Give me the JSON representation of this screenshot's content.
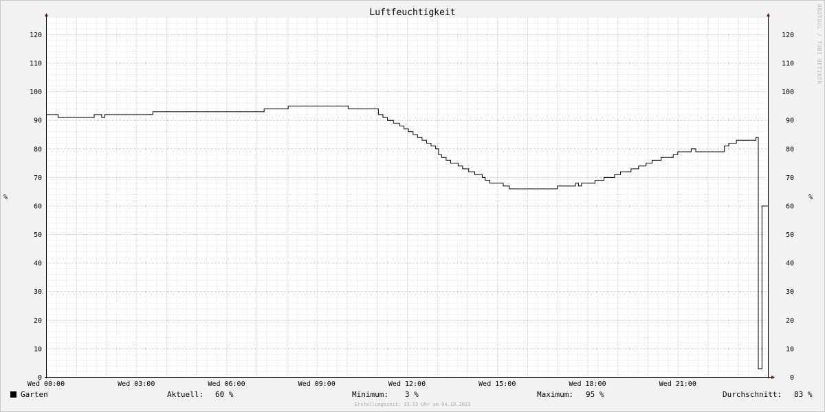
{
  "chart_data": {
    "type": "line",
    "title": "Luftfeuchtigkeit",
    "ylabel_left": "%",
    "ylabel_right": "%",
    "ylim": [
      0,
      126
    ],
    "yticks": [
      0,
      10,
      20,
      30,
      40,
      50,
      60,
      70,
      80,
      90,
      100,
      110,
      120
    ],
    "xlim_hours": [
      0,
      24
    ],
    "xticks": [
      {
        "hour": 0,
        "label": "Wed 00:00"
      },
      {
        "hour": 3,
        "label": "Wed 03:00"
      },
      {
        "hour": 6,
        "label": "Wed 06:00"
      },
      {
        "hour": 9,
        "label": "Wed 09:00"
      },
      {
        "hour": 12,
        "label": "Wed 12:00"
      },
      {
        "hour": 15,
        "label": "Wed 15:00"
      },
      {
        "hour": 18,
        "label": "Wed 18:00"
      },
      {
        "hour": 21,
        "label": "Wed 21:00"
      }
    ],
    "grid": true,
    "series": [
      {
        "name": "Garten",
        "color": "#000000",
        "step": true,
        "points": [
          [
            0.0,
            92
          ],
          [
            0.4,
            91
          ],
          [
            1.6,
            92
          ],
          [
            1.85,
            91
          ],
          [
            1.95,
            92
          ],
          [
            3.55,
            93
          ],
          [
            7.25,
            94
          ],
          [
            8.05,
            95
          ],
          [
            10.05,
            94
          ],
          [
            11.05,
            92
          ],
          [
            11.2,
            91
          ],
          [
            11.35,
            90
          ],
          [
            11.55,
            89
          ],
          [
            11.75,
            88
          ],
          [
            11.9,
            87
          ],
          [
            12.05,
            86
          ],
          [
            12.2,
            85
          ],
          [
            12.35,
            84
          ],
          [
            12.5,
            83
          ],
          [
            12.65,
            82
          ],
          [
            12.8,
            81
          ],
          [
            12.95,
            80
          ],
          [
            13.05,
            78
          ],
          [
            13.15,
            77
          ],
          [
            13.3,
            76
          ],
          [
            13.45,
            75
          ],
          [
            13.7,
            74
          ],
          [
            13.85,
            73
          ],
          [
            14.05,
            72
          ],
          [
            14.25,
            71
          ],
          [
            14.5,
            70
          ],
          [
            14.6,
            69
          ],
          [
            14.75,
            68
          ],
          [
            15.2,
            67
          ],
          [
            15.4,
            66
          ],
          [
            17.0,
            67
          ],
          [
            17.6,
            68
          ],
          [
            17.7,
            67
          ],
          [
            17.8,
            68
          ],
          [
            18.25,
            69
          ],
          [
            18.55,
            70
          ],
          [
            18.9,
            71
          ],
          [
            19.1,
            72
          ],
          [
            19.45,
            73
          ],
          [
            19.7,
            74
          ],
          [
            19.95,
            75
          ],
          [
            20.15,
            76
          ],
          [
            20.45,
            77
          ],
          [
            20.85,
            78
          ],
          [
            21.0,
            79
          ],
          [
            21.45,
            80
          ],
          [
            21.6,
            79
          ],
          [
            22.55,
            81
          ],
          [
            22.7,
            82
          ],
          [
            22.95,
            83
          ],
          [
            23.6,
            84
          ],
          [
            23.68,
            3
          ],
          [
            23.78,
            3
          ],
          [
            23.8,
            60
          ],
          [
            24.0,
            60
          ]
        ]
      }
    ],
    "legend": {
      "series_label": "Garten",
      "current_label": "Aktuell:",
      "current_value": "60 %",
      "min_label": "Minimum:",
      "min_value": "3 %",
      "max_label": "Maximum:",
      "max_value": "95 %",
      "avg_label": "Durchschnitt:",
      "avg_value": "83 %"
    },
    "footer": "Erstellungszeit: 23:55 Uhr am 04.10.2023",
    "watermark": "RRDTOOL / TOBI OETIKER"
  }
}
